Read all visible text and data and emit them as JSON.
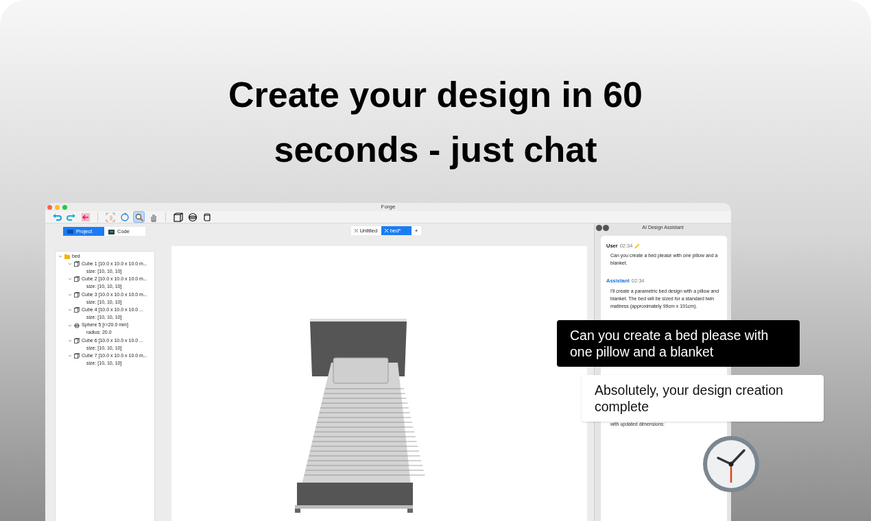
{
  "headline": [
    "Create your design in 60",
    "seconds - just chat"
  ],
  "window": {
    "title": "Forge"
  },
  "toolbar": [
    {
      "kind": "undo",
      "selected": false
    },
    {
      "kind": "redo",
      "selected": false
    },
    {
      "kind": "export",
      "selected": false
    },
    {
      "kind": "sep"
    },
    {
      "kind": "fit",
      "selected": false
    },
    {
      "kind": "rotate",
      "selected": false
    },
    {
      "kind": "zoom",
      "selected": true
    },
    {
      "kind": "pan",
      "selected": false
    },
    {
      "kind": "sep"
    },
    {
      "kind": "cube",
      "selected": false
    },
    {
      "kind": "sphere",
      "selected": false
    },
    {
      "kind": "cylinder",
      "selected": false
    }
  ],
  "panel_tabs": [
    {
      "label": "Project",
      "kind": "project",
      "selected": true
    },
    {
      "label": "Code",
      "kind": "code",
      "selected": false
    }
  ],
  "tree": [
    {
      "label": "bed",
      "kind": "folder",
      "expanded": true,
      "children": [
        {
          "label": "Cube 1 [10.0 x 10.0 x 10.0 m...",
          "kind": "cube",
          "expanded": true,
          "children": [
            {
              "label": "size: [10, 10, 10]"
            }
          ]
        },
        {
          "label": "Cube 2 [10.0 x 10.0 x 10.0 m...",
          "kind": "cube",
          "expanded": true,
          "children": [
            {
              "label": "size: [10, 10, 10]"
            }
          ]
        },
        {
          "label": "Cube 3 [10.0 x 10.0 x 10.0 m...",
          "kind": "cube",
          "expanded": true,
          "children": [
            {
              "label": "size: [10, 10, 10]"
            }
          ]
        },
        {
          "label": "Cube 4 [10.0 x 10.0 x 10.0 ...",
          "kind": "cube",
          "expanded": true,
          "children": [
            {
              "label": "size: [10, 10, 10]"
            }
          ]
        },
        {
          "label": "Sphere 5 [r=20.0 mm]",
          "kind": "sphere",
          "expanded": true,
          "children": [
            {
              "label": "radius: 20.0"
            }
          ]
        },
        {
          "label": "Cube 6 [10.0 x 10.0 x 10.0 ...",
          "kind": "cube",
          "expanded": true,
          "children": [
            {
              "label": "size: [10, 10, 10]"
            }
          ]
        },
        {
          "label": "Cube 7 [10.0 x 10.0 x 10.0 m...",
          "kind": "cube",
          "expanded": true,
          "children": [
            {
              "label": "size: [10, 10, 10]"
            }
          ]
        }
      ]
    }
  ],
  "doc_tabs": [
    {
      "label": "Untitled",
      "selected": false
    },
    {
      "label": "bed*",
      "selected": true
    }
  ],
  "add_tab": "+",
  "assistant": {
    "title": "AI Design Assistant",
    "messages": [
      {
        "kind": "user",
        "author": "User",
        "time": "02:34",
        "text": "Can you create a bed please with one pillow and a blanket."
      },
      {
        "kind": "assistant",
        "author": "Assistant",
        "time": "02:34",
        "text": "I'll create a parametric bed design with a pillow and blanket. The bed will be sized for a standard twin mattress (approximately 99cm x 191cm)."
      }
    ],
    "trailing_text": "with updated dimensions:"
  },
  "callouts": [
    {
      "kind": "dark",
      "text": "Can you create a bed please with one pillow and a blanket"
    },
    {
      "kind": "light",
      "text": "Absolutely, your design creation complete"
    }
  ]
}
